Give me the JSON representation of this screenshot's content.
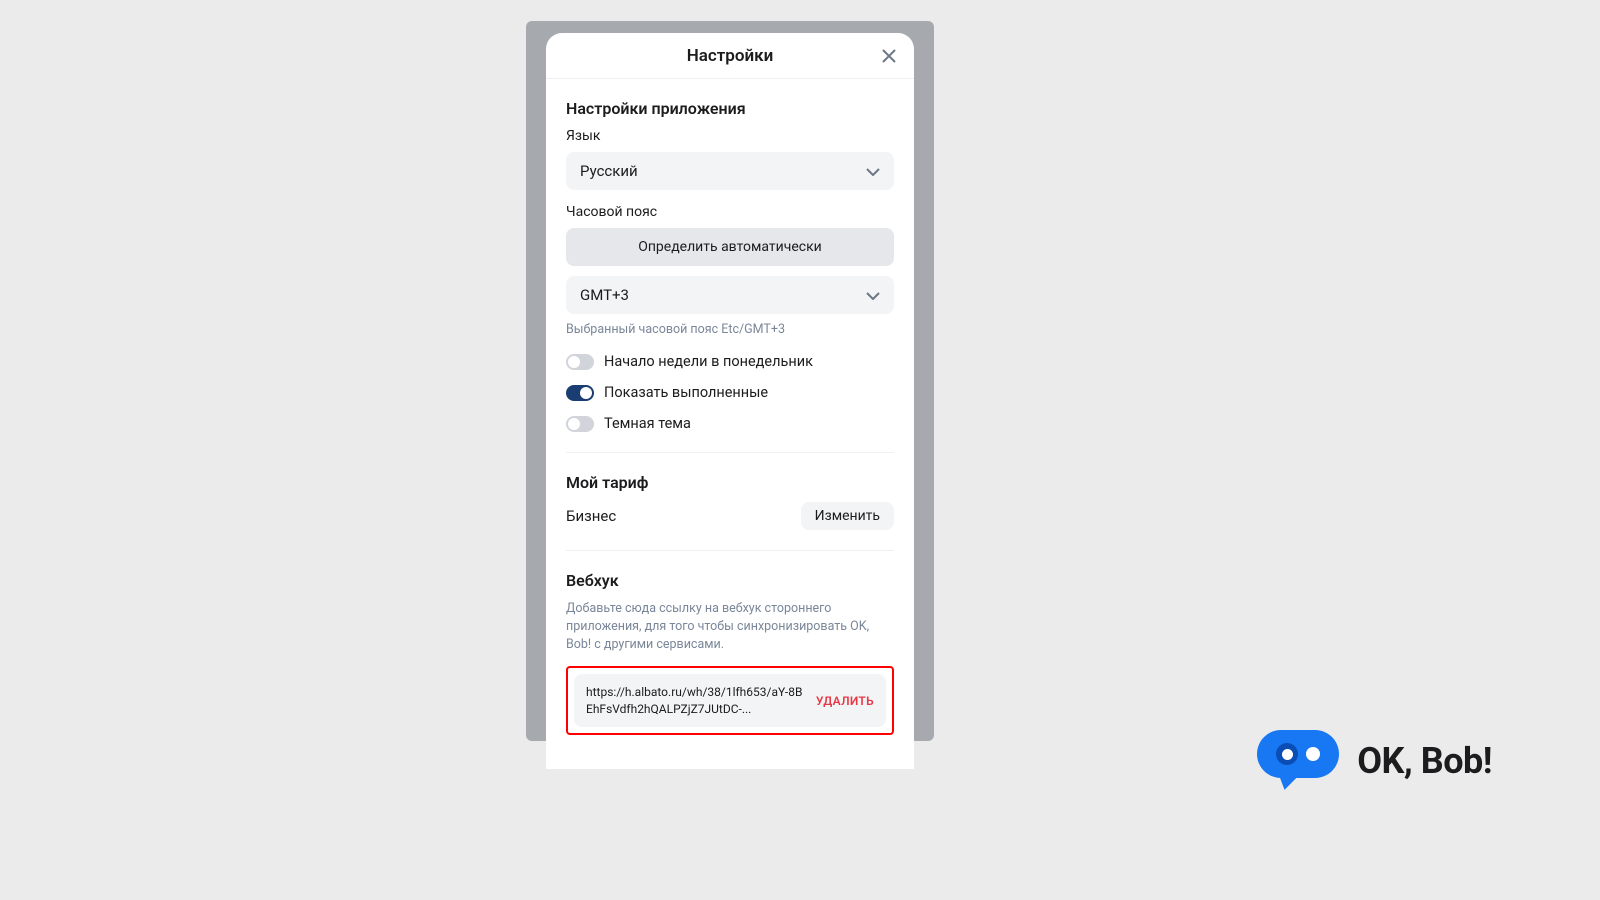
{
  "modal": {
    "title": "Настройки"
  },
  "appSettings": {
    "heading": "Настройки приложения",
    "languageLabel": "Язык",
    "languageValue": "Русский",
    "timezoneLabel": "Часовой пояс",
    "autoDetectLabel": "Определить автоматически",
    "timezoneValue": "GMT+3",
    "timezoneHint": "Выбранный часовой пояс Etc/GMT+3",
    "toggles": {
      "weekStart": "Начало недели в понедельник",
      "showCompleted": "Показать выполненные",
      "darkTheme": "Темная тема"
    }
  },
  "tariff": {
    "heading": "Мой тариф",
    "planName": "Бизнес",
    "changeLabel": "Изменить"
  },
  "webhook": {
    "heading": "Вебхук",
    "description": "Добавьте сюда ссылку на вебхук стороннего приложения, для того чтобы синхронизировать OK, Bob! с другими сервисами.",
    "url": "https://h.albato.ru/wh/38/1lfh653/aY-8BEhFsVdfh2hQALPZjZ7JUtDC-...",
    "deleteLabel": "УДАЛИТЬ"
  },
  "brand": {
    "name": "OK, Bob!"
  }
}
